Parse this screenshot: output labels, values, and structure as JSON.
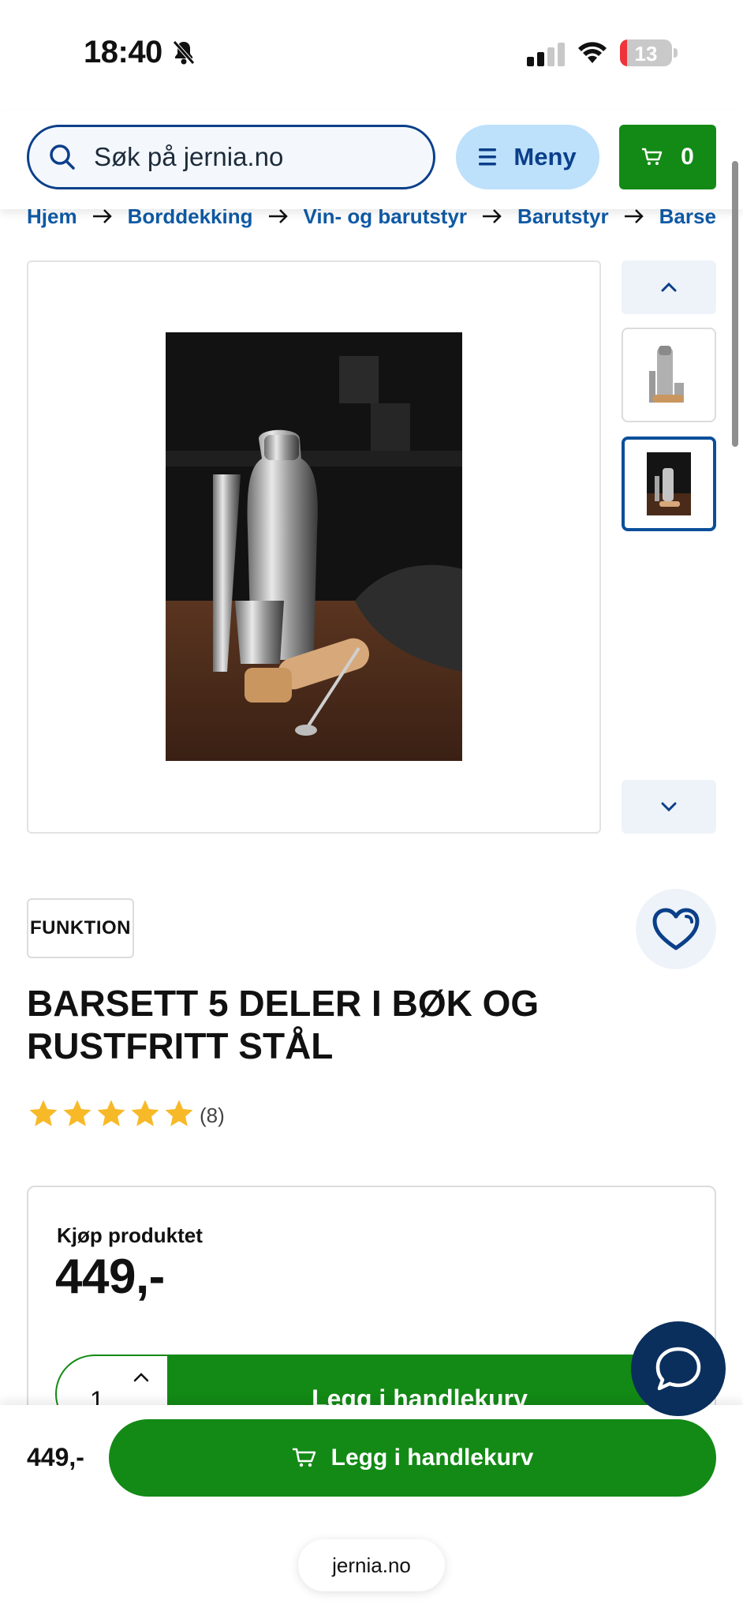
{
  "status_bar": {
    "time": "18:40",
    "battery": "13",
    "battery_level": 0.13,
    "icons": [
      "bell-slash-icon",
      "cellular-signal-icon",
      "wifi-icon",
      "battery-icon"
    ]
  },
  "header": {
    "search_placeholder": "Søk på jernia.no",
    "menu_label": "Meny",
    "cart_count": "0"
  },
  "breadcrumb": [
    "Hjem",
    "Borddekking",
    "Vin- og barutstyr",
    "Barutstyr",
    "Barse"
  ],
  "gallery": {
    "image_alt": "Barsett med shaker, isklype, målebeger, morter og barskje på trebord"
  },
  "product": {
    "brand": "FUNKTION",
    "title_line1": "BARSETT 5 DELER I BØK OG",
    "title_line2": "RUSTFRITT STÅL",
    "rating": 5,
    "rating_max": 5,
    "review_count": "(8)"
  },
  "buy": {
    "label": "Kjøp produktet",
    "price": "449,-",
    "quantity": "1",
    "add_to_cart": "Legg i handlekurv"
  },
  "sticky": {
    "price": "449,-",
    "add_to_cart": "Legg i handlekurv"
  },
  "browser": {
    "domain": "jernia.no"
  },
  "colors": {
    "brand_blue": "#0b3f8a",
    "link_blue": "#0f5aa6",
    "menu_bg": "#bde0fb",
    "green": "#138a16",
    "star": "#f7b928",
    "chat_bg": "#0a2f5c"
  }
}
